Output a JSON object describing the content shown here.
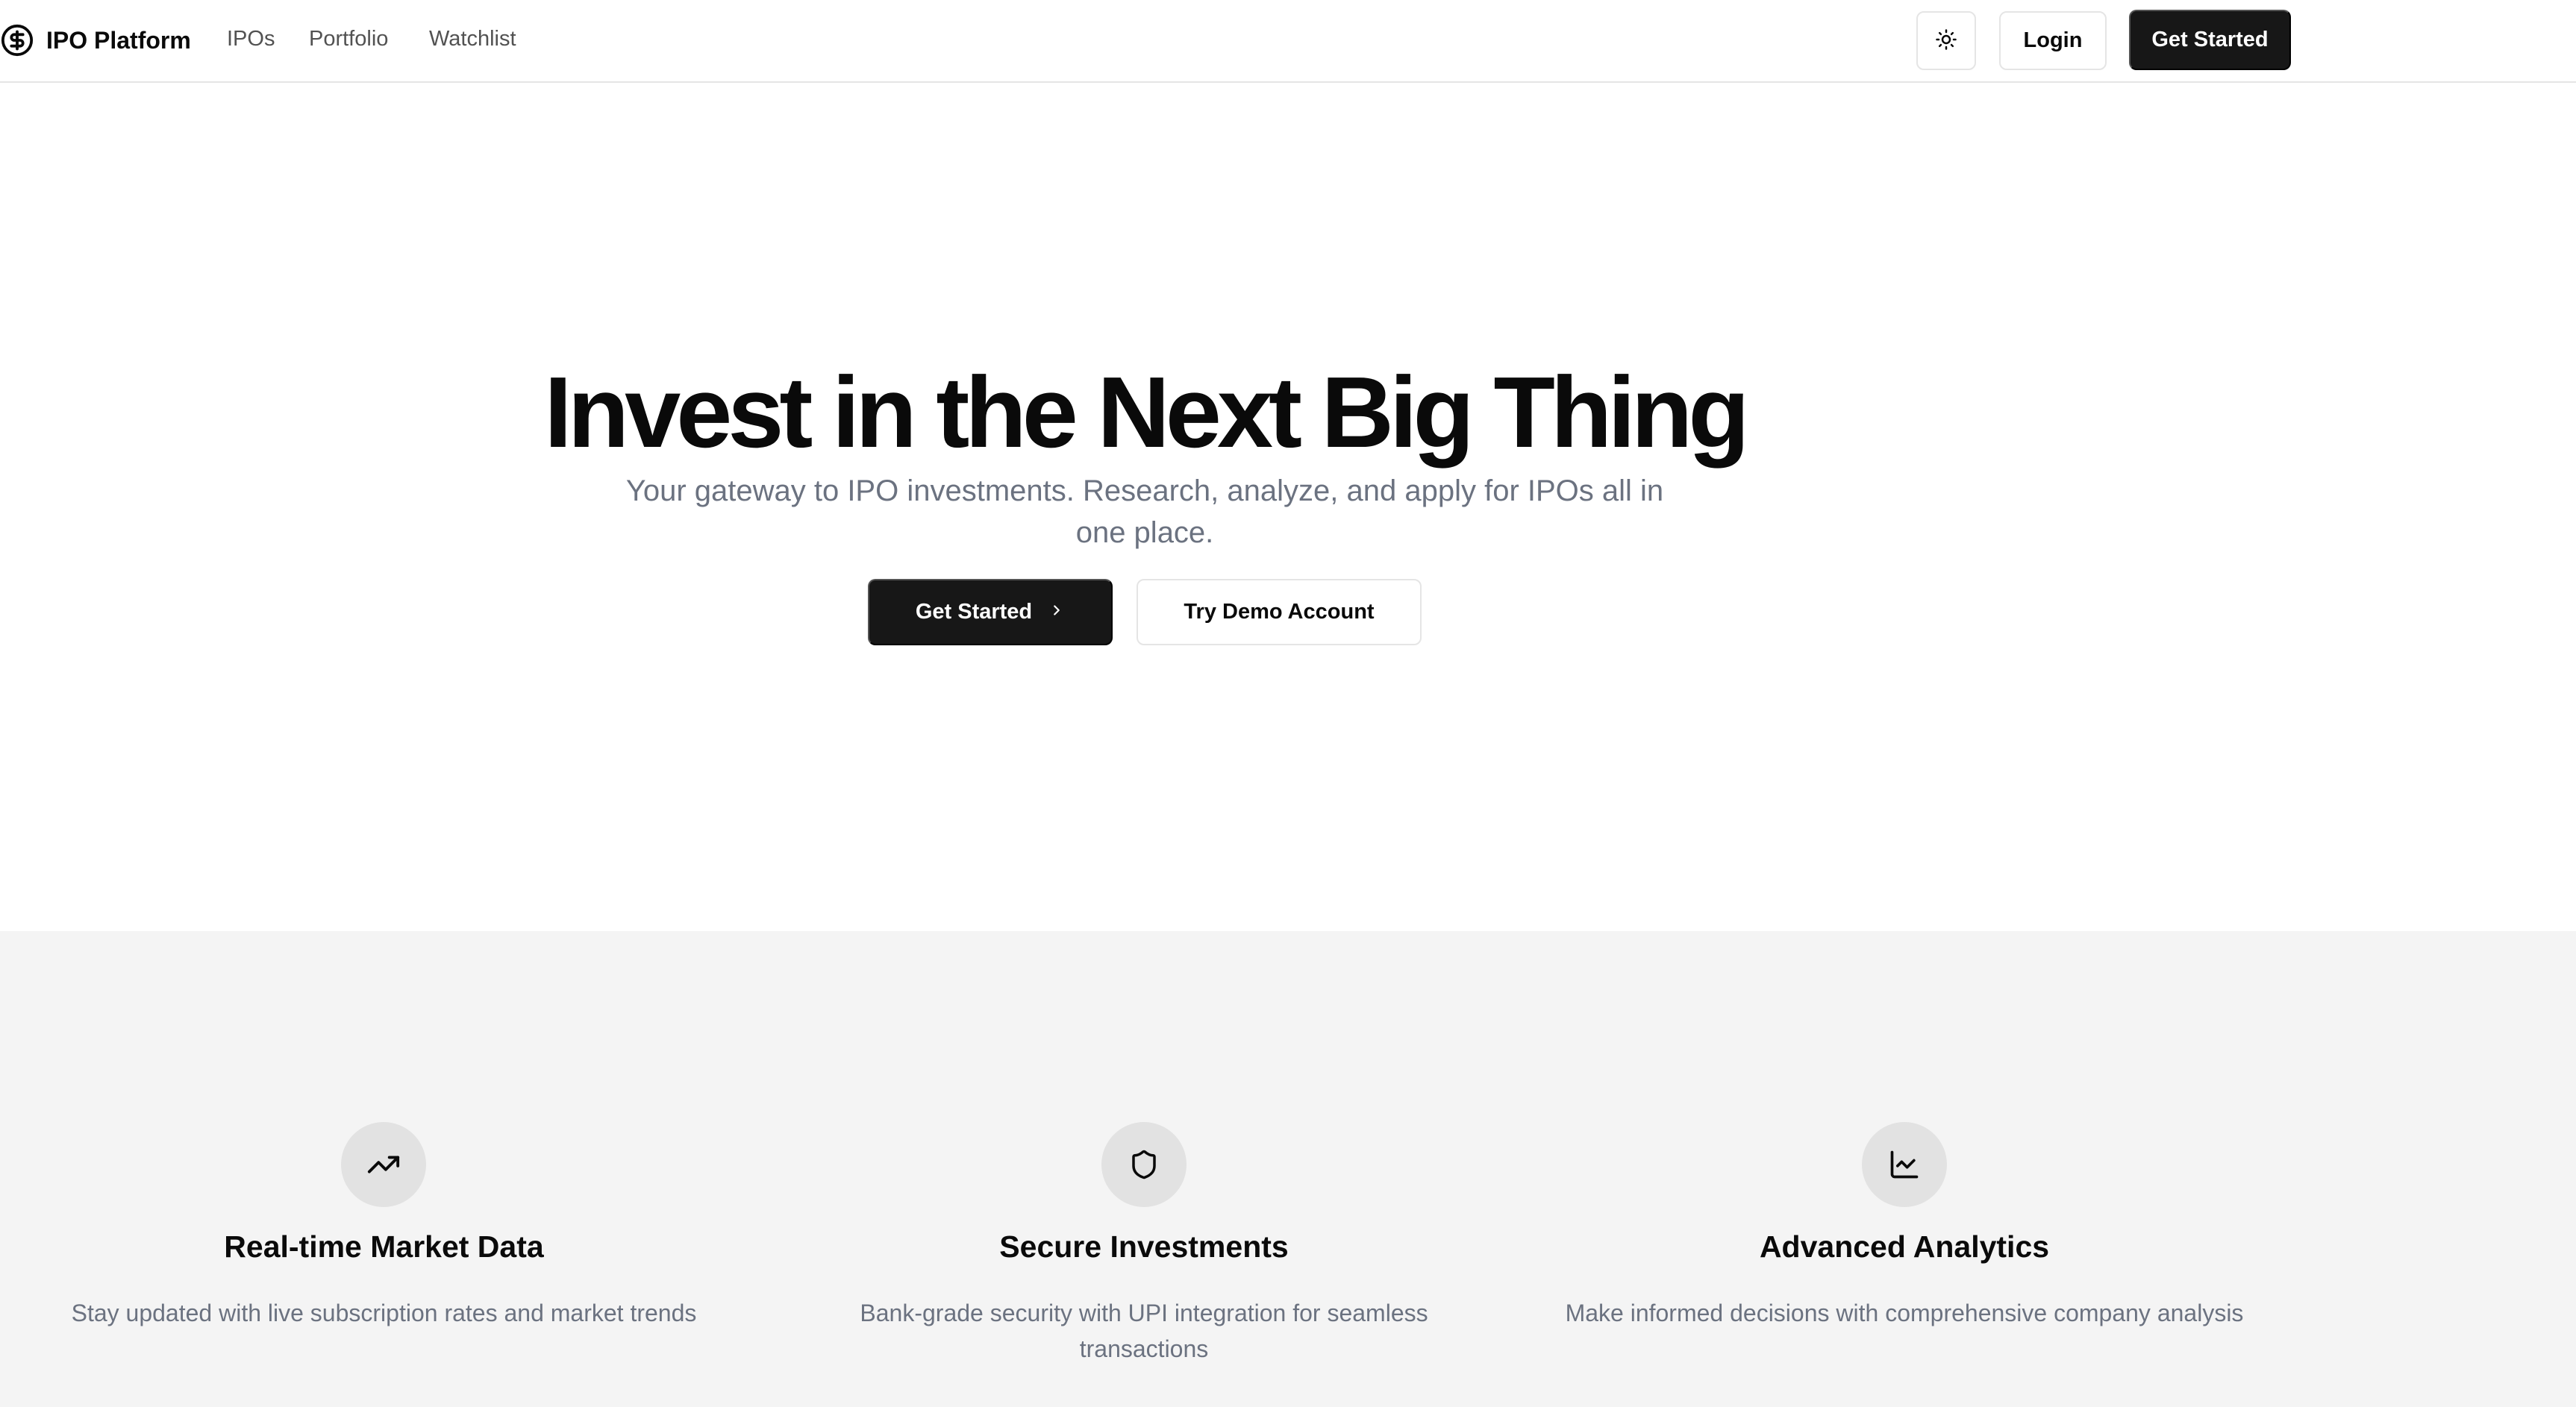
{
  "header": {
    "brand_name": "IPO Platform",
    "brand_icon": "dollar-circle-icon",
    "nav": [
      "IPOs",
      "Portfolio",
      "Watchlist"
    ],
    "theme_toggle_icon": "sun-icon",
    "login_label": "Login",
    "cta_label": "Get Started"
  },
  "hero": {
    "title": "Invest in the Next Big Thing",
    "subtitle": "Your gateway to IPO investments. Research, analyze, and apply for IPOs all in one place.",
    "primary_label": "Get Started",
    "primary_icon": "chevron-right-icon",
    "secondary_label": "Try Demo Account"
  },
  "features": [
    {
      "icon": "trending-up-icon",
      "title": "Real-time Market Data",
      "description": "Stay updated with live subscription rates and market trends"
    },
    {
      "icon": "shield-icon",
      "title": "Secure Investments",
      "description": "Bank-grade security with UPI integration for seamless transactions"
    },
    {
      "icon": "line-chart-icon",
      "title": "Advanced Analytics",
      "description": "Make informed decisions with comprehensive company analysis"
    }
  ],
  "colors": {
    "primary": "#171717",
    "muted_text": "#6b7280",
    "section_bg": "#f4f4f4",
    "icon_bg": "#e2e2e2"
  }
}
